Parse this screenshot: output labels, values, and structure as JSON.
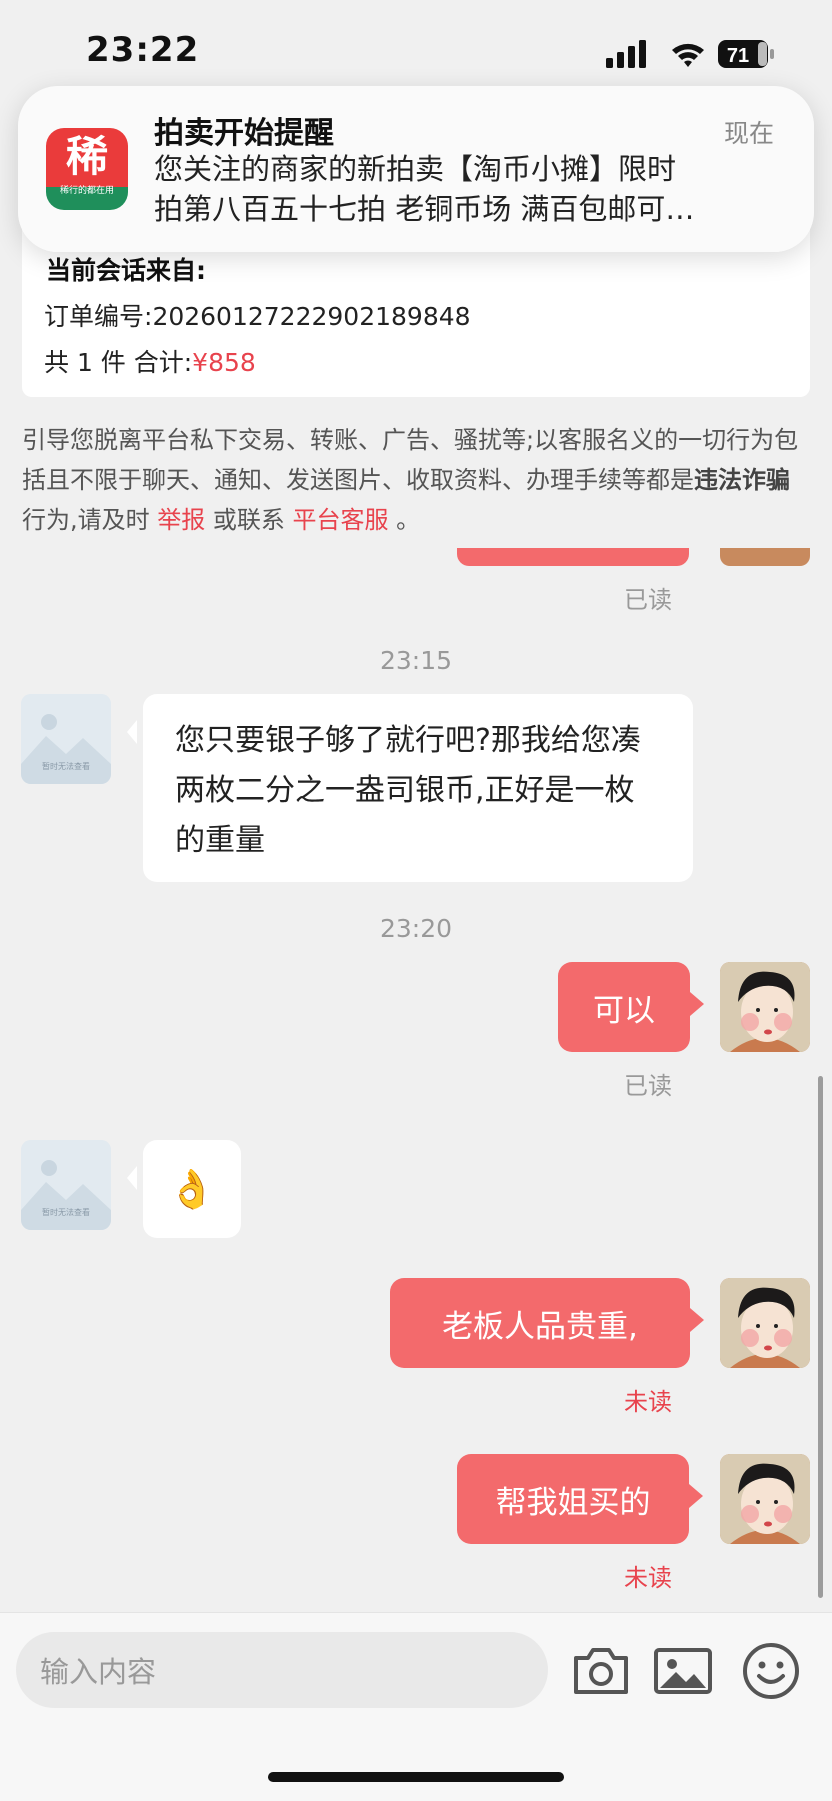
{
  "status_bar": {
    "time": "23:22",
    "battery": "71"
  },
  "notification": {
    "app_glyph": "稀",
    "app_slogan": "稀行的都在用",
    "title": "拍卖开始提醒",
    "time": "现在",
    "line1": "您关注的商家的新拍卖【淘币小摊】限时",
    "line2": "拍第八百五十七拍  老铜币场  满百包邮可…"
  },
  "order": {
    "header": "当前会话来自:",
    "order_number_label": "订单编号:",
    "order_number": "20260127222902189848",
    "count_label": "共 1 件  合计:",
    "total": "¥858"
  },
  "warning": {
    "text1": "引导您脱离平台私下交易、转账、广告、骚扰等;以客服名义的一切行为包括且不限于聊天、通知、发送图片、收取资料、办理手续等都是",
    "bold": "违法诈骗",
    "text2": "行为,请及时 ",
    "report_link": "举报",
    "text3": " 或联系 ",
    "service_link": "平台客服",
    "text4": " 。"
  },
  "chat": {
    "status_read": "已读",
    "status_unread": "未读",
    "placeholder_caption": "暂时无法查看",
    "timestamp1": "23:15",
    "msg1": "您只要银子够了就行吧?那我给您凑两枚二分之一盎司银币,正好是一枚的重量",
    "timestamp2": "23:20",
    "msg2": "可以",
    "msg3": "👌",
    "msg4": "老板人品贵重,",
    "msg5": "帮我姐买的"
  },
  "input": {
    "placeholder": "输入内容"
  },
  "colors": {
    "accent": "#f36a6c",
    "price_red": "#e8434d"
  },
  "icons": [
    "signal-icon",
    "wifi-icon",
    "battery-icon",
    "camera-icon",
    "image-icon",
    "emoji-icon"
  ]
}
